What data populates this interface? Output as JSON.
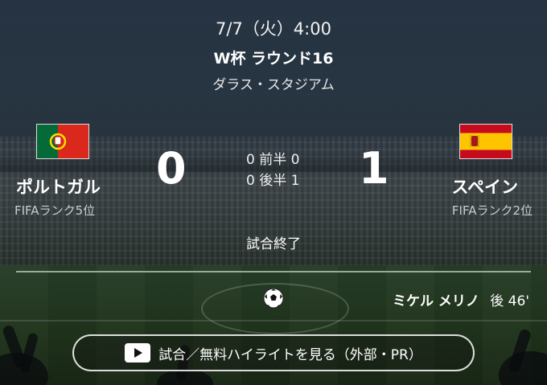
{
  "match": {
    "date": "7/7（火）4:00",
    "tournament": "W杯 ラウンド16",
    "stadium": "ダラス・スタジアム",
    "status": "試合終了"
  },
  "home": {
    "name": "ポルトガル",
    "rank": "FIFAランク5位",
    "score": "0",
    "flag": "portugal-flag"
  },
  "away": {
    "name": "スペイン",
    "rank": "FIFAランク2位",
    "score": "1",
    "flag": "spain-flag"
  },
  "halves": {
    "first": "0 前半 0",
    "second": "0 後半 1"
  },
  "goal": {
    "icon": "soccer-ball-icon",
    "scorer": "ミケル メリノ",
    "time": "後 46'"
  },
  "highlight": {
    "label": "試合／無料ハイライトを見る（外部・PR）",
    "icon": "play-icon"
  },
  "colors": {
    "text": "#ffffff",
    "subtext": "#c9ccd0",
    "portugal_green": "#046a38",
    "portugal_red": "#da291c",
    "spain_red": "#c60b1e",
    "spain_yellow": "#ffc400"
  }
}
